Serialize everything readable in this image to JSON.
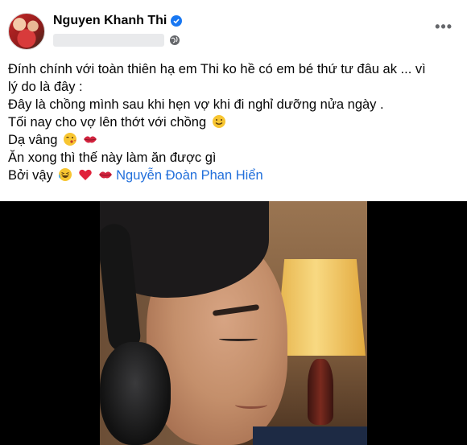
{
  "post": {
    "author": "Nguyen Khanh Thi",
    "verified": true,
    "privacy_icon": "globe-icon",
    "more_label": "•••",
    "lines": [
      "Đính chính với toàn thiên hạ em Thi ko hề có em bé thứ tư đâu ak ... vì",
      "lý do là đây :",
      "Đây là chồng mình sau khi hẹn vợ khi đi nghỉ dưỡng nửa ngày .",
      "Tối  nay cho vợ lên thớt với chồng",
      "Dạ vâng",
      "Ăn xong thì thế này làm ăn được gì",
      "Bởi vậy"
    ],
    "mention": "Nguyễn Đoàn Phan Hiển",
    "emojis": {
      "line4": "smile-emoji",
      "line5": [
        "wink-kiss-emoji",
        "lips-emoji"
      ],
      "line7": [
        "laughing-emoji",
        "red-heart-emoji",
        "lips-emoji"
      ]
    }
  },
  "colors": {
    "mention": "#216fdb",
    "verified": "#1877f2",
    "text": "#050505",
    "muted": "#65676b"
  }
}
